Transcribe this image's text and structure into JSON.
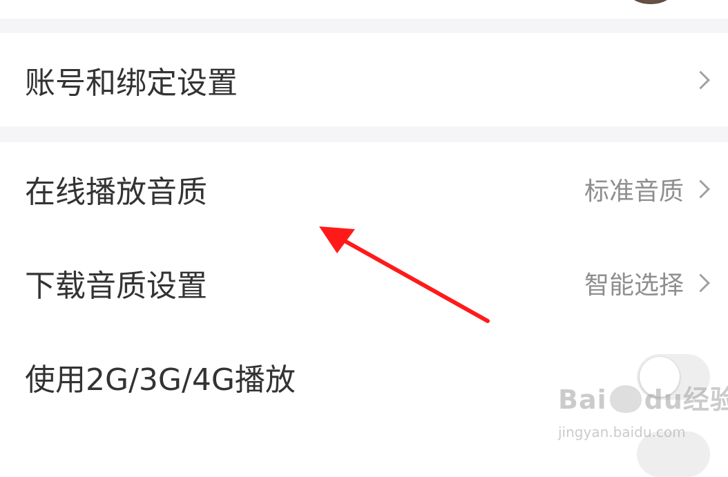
{
  "sections": [
    {
      "rows": [
        {
          "label": "账号和绑定设置",
          "value": "",
          "control": "chevron"
        }
      ]
    },
    {
      "rows": [
        {
          "label": "在线播放音质",
          "value": "标准音质",
          "control": "chevron"
        },
        {
          "label": "下载音质设置",
          "value": "智能选择",
          "control": "chevron"
        },
        {
          "label": "使用2G/3G/4G播放",
          "value": "",
          "control": "toggle",
          "toggle_on": false
        }
      ]
    }
  ],
  "watermark": {
    "logo_text_left": "Bai",
    "logo_text_right": "经验",
    "paw_text": "du",
    "url": "jingyan.baidu.com"
  },
  "annotation": {
    "color": "#ff1a1a"
  }
}
